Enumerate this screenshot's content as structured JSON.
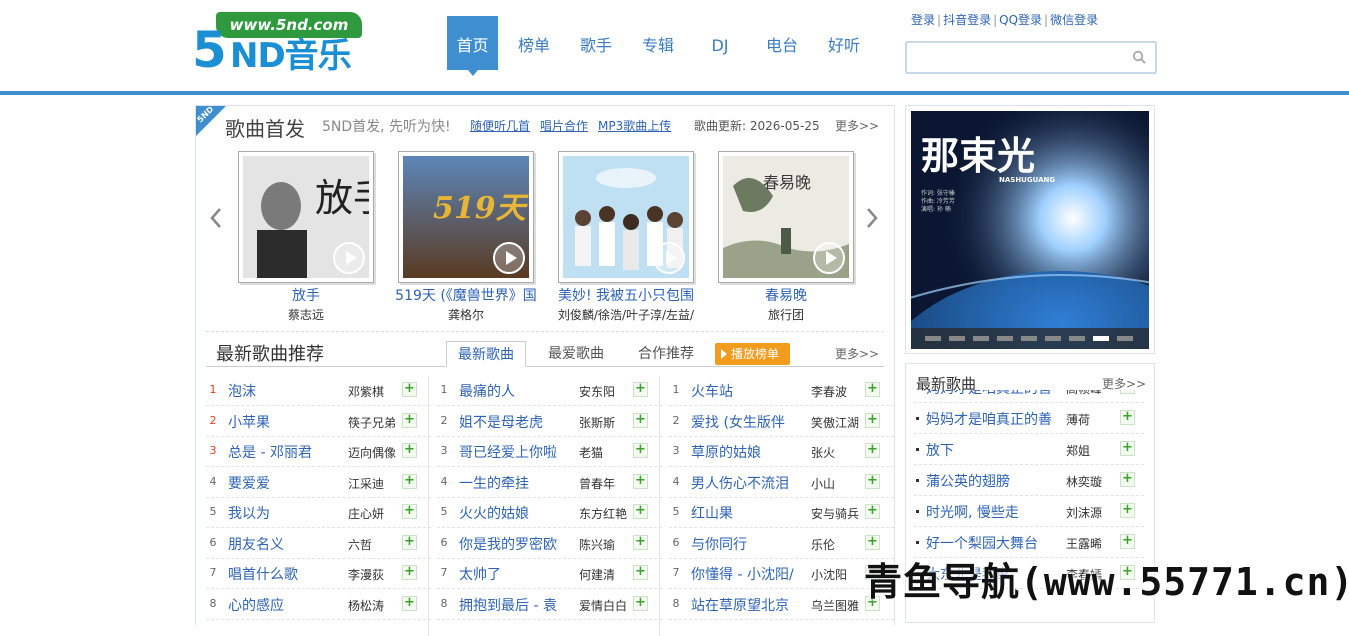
{
  "header": {
    "logo_url": "www.5nd.com",
    "logo_5": "5",
    "logo_text": "ND音乐",
    "nav": [
      {
        "label": "首页",
        "active": true
      },
      {
        "label": "榜单",
        "active": false
      },
      {
        "label": "歌手",
        "active": false
      },
      {
        "label": "专辑",
        "active": false
      },
      {
        "label": "DJ",
        "active": false
      },
      {
        "label": "电台",
        "active": false
      },
      {
        "label": "好听",
        "active": false
      }
    ],
    "login_links": [
      "登录",
      "抖音登录",
      "QQ登录",
      "微信登录"
    ],
    "search_placeholder": ""
  },
  "first_release": {
    "corner_tag": "5ND",
    "title": "歌曲首发",
    "subtitle": "5ND首发, 先听为快!",
    "links": [
      "随便听几首",
      "唱片合作",
      "MP3歌曲上传"
    ],
    "update_text": "歌曲更新: 2026-05-25",
    "more": "更多>>",
    "albums": [
      {
        "title": "放手",
        "artist": "蔡志远",
        "cover_text": "放手"
      },
      {
        "title": "519天 (《魔兽世界》国",
        "artist": "龚格尔",
        "cover_text": "519天"
      },
      {
        "title": "美妙! 我被五小只包围",
        "artist": "刘俊麟/徐浩/叶子淳/左益/",
        "cover_text": ""
      },
      {
        "title": "春易晚",
        "artist": "旅行团",
        "cover_text": "春易晚"
      }
    ]
  },
  "recommend": {
    "title": "最新歌曲推荐",
    "tabs": [
      {
        "label": "最新歌曲",
        "active": true
      },
      {
        "label": "最爱歌曲",
        "active": false
      },
      {
        "label": "合作推荐",
        "active": false
      }
    ],
    "play_chart": "播放榜单",
    "more": "更多>>",
    "columns": [
      [
        {
          "num": "1",
          "name": "泡沫",
          "artist": "邓紫棋",
          "hot": true
        },
        {
          "num": "2",
          "name": "小苹果",
          "artist": "筷子兄弟",
          "hot": true
        },
        {
          "num": "3",
          "name": "总是 - 邓丽君",
          "artist": "迈向偶像",
          "hot": true
        },
        {
          "num": "4",
          "name": "要爱爱",
          "artist": "江采迪",
          "hot": false
        },
        {
          "num": "5",
          "name": "我以为",
          "artist": "庄心妍",
          "hot": false
        },
        {
          "num": "6",
          "name": "朋友名义",
          "artist": "六哲",
          "hot": false
        },
        {
          "num": "7",
          "name": "唱首什么歌",
          "artist": "李漫荻",
          "hot": false
        },
        {
          "num": "8",
          "name": "心的感应",
          "artist": "杨松涛",
          "hot": false
        }
      ],
      [
        {
          "num": "1",
          "name": "最痛的人",
          "artist": "安东阳",
          "hot": false
        },
        {
          "num": "2",
          "name": "姐不是母老虎",
          "artist": "张斯斯",
          "hot": false
        },
        {
          "num": "3",
          "name": "哥已经爱上你啦",
          "artist": "老猫",
          "hot": false
        },
        {
          "num": "4",
          "name": "一生的牵挂",
          "artist": "曾春年",
          "hot": false
        },
        {
          "num": "5",
          "name": "火火的姑娘",
          "artist": "东方红艳",
          "hot": false
        },
        {
          "num": "6",
          "name": "你是我的罗密欧",
          "artist": "陈兴瑜",
          "hot": false
        },
        {
          "num": "7",
          "name": "太帅了",
          "artist": "何建清",
          "hot": false
        },
        {
          "num": "8",
          "name": "拥抱到最后 - 袁",
          "artist": "爱情白白",
          "hot": false
        }
      ],
      [
        {
          "num": "1",
          "name": "火车站",
          "artist": "李春波",
          "hot": false
        },
        {
          "num": "2",
          "name": "爱找 (女生版伴",
          "artist": "笑傲江湖",
          "hot": false
        },
        {
          "num": "3",
          "name": "草原的姑娘",
          "artist": "张火",
          "hot": false
        },
        {
          "num": "4",
          "name": "男人伤心不流泪",
          "artist": "小山",
          "hot": false
        },
        {
          "num": "5",
          "name": "红山果",
          "artist": "安与骑兵",
          "hot": false
        },
        {
          "num": "6",
          "name": "与你同行",
          "artist": "乐伦",
          "hot": false
        },
        {
          "num": "7",
          "name": "你懂得 - 小沈阳/",
          "artist": "小沈阳",
          "hot": false
        },
        {
          "num": "8",
          "name": "站在草原望北京",
          "artist": "乌兰图雅",
          "hot": false
        }
      ]
    ]
  },
  "slideshow": {
    "title_art": "那束光",
    "sub_art": "NASHUGUANG",
    "credits": [
      "作词: 张守榛",
      "作曲: 冷芳芳",
      "演唱: 孙 楠"
    ],
    "dot_count": 9,
    "active_dot": 7
  },
  "latest": {
    "title": "最新歌曲",
    "more": "更多>>",
    "items": [
      {
        "name": "妈妈才是咱真正的善",
        "artist": "高帧峰"
      },
      {
        "name": "妈妈才是咱真正的善",
        "artist": "薄荷"
      },
      {
        "name": "放下",
        "artist": "郑姐"
      },
      {
        "name": "蒲公英的翅膀",
        "artist": "林奕璇"
      },
      {
        "name": "时光啊, 慢些走",
        "artist": "刘沫源"
      },
      {
        "name": "好一个梨园大舞台",
        "artist": "王露晞"
      },
      {
        "name": "大东北是我家",
        "artist": "李春嫣"
      }
    ]
  },
  "watermark": "青鱼导航(www.55771.cn)"
}
